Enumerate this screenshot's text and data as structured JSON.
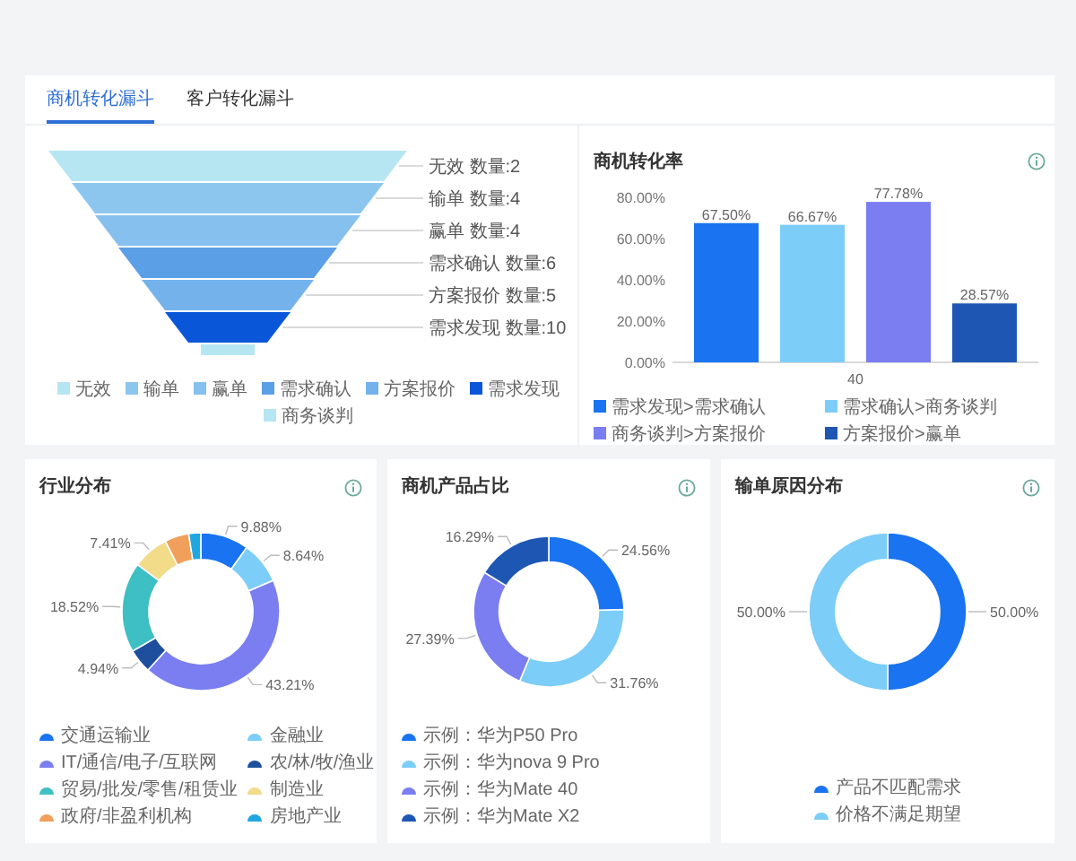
{
  "tabs": [
    {
      "label": "商机转化漏斗",
      "selected": true
    },
    {
      "label": "客户转化漏斗",
      "selected": false
    }
  ],
  "funnel": {
    "layers": [
      {
        "label": "无效 数量:2",
        "color": "#b6e6f2"
      },
      {
        "label": "输单 数量:4",
        "color": "#8cc6ef"
      },
      {
        "label": "赢单 数量:4",
        "color": "#86c0ee"
      },
      {
        "label": "需求确认 数量:6",
        "color": "#5b9fe6"
      },
      {
        "label": "方案报价 数量:5",
        "color": "#74b2ec"
      },
      {
        "label": "需求发现 数量:10",
        "color": "#0a56d8"
      },
      {
        "color": "#b6e6f2"
      }
    ],
    "legend": [
      {
        "name": "无效",
        "color": "#b6e6f2"
      },
      {
        "name": "输单",
        "color": "#8cc6ef"
      },
      {
        "name": "赢单",
        "color": "#86c0ee"
      },
      {
        "name": "需求确认",
        "color": "#5b9fe6"
      },
      {
        "name": "方案报价",
        "color": "#74b2ec"
      },
      {
        "name": "需求发现",
        "color": "#0a56d8"
      },
      {
        "name": "商务谈判",
        "color": "#b6e6f2"
      }
    ]
  },
  "rate_panel": {
    "title": "商机转化率",
    "chart_data": {
      "type": "bar",
      "categories": [
        "40"
      ],
      "series": [
        {
          "name": "需求发现>需求确认",
          "color": "#1a73f0",
          "values": [
            67.5
          ]
        },
        {
          "name": "需求确认>商务谈判",
          "color": "#7ccdf8",
          "values": [
            66.67
          ]
        },
        {
          "name": "商务谈判>方案报价",
          "color": "#7a7ef0",
          "values": [
            77.78
          ]
        },
        {
          "name": "方案报价>赢单",
          "color": "#1d57b3",
          "values": [
            28.57
          ]
        }
      ],
      "ylim": [
        0,
        80
      ],
      "yticks": [
        {
          "value": 0,
          "label": "0.00%"
        },
        {
          "value": 20,
          "label": "20.00%"
        },
        {
          "value": 40,
          "label": "40.00%"
        },
        {
          "value": 60,
          "label": "60.00%"
        },
        {
          "value": 80,
          "label": "80.00%"
        }
      ],
      "value_labels": [
        "67.50%",
        "66.67%",
        "77.78%",
        "28.57%"
      ]
    }
  },
  "cards": [
    {
      "title": "行业分布",
      "chart_data": {
        "type": "donut",
        "categories": [
          "交通运输业",
          "金融业",
          "IT/通信/电子/互联网",
          "农/林/牧/渔业",
          "贸易/批发/零售/租赁业",
          "制造业",
          "政府/非盈利机构",
          "房地产业"
        ],
        "values": [
          9.88,
          8.64,
          43.21,
          4.94,
          18.52,
          7.41,
          4.94,
          2.47
        ],
        "colors": [
          "#1a73f0",
          "#7ccdf8",
          "#7a7ef0",
          "#1d4f9e",
          "#3dbfc4",
          "#f2dc8a",
          "#f0a05a",
          "#21a7e0"
        ],
        "value_labels": [
          "9.88%",
          "8.64%",
          "43.21%",
          "4.94%",
          "18.52%",
          "7.41%",
          null,
          null
        ],
        "legend": "bottom"
      }
    },
    {
      "title": "商机产品占比",
      "chart_data": {
        "type": "donut",
        "categories": [
          "示例：华为P50 Pro",
          "示例：华为nova 9 Pro",
          "示例：华为Mate 40",
          "示例：华为Mate X2"
        ],
        "values": [
          24.56,
          31.76,
          27.39,
          16.29
        ],
        "colors": [
          "#1a73f0",
          "#7ccdf8",
          "#7a7ef0",
          "#1d57b3"
        ],
        "value_labels": [
          "24.56%",
          "31.76%",
          "27.39%",
          "16.29%"
        ],
        "legend": "bottom"
      }
    },
    {
      "title": "输单原因分布",
      "chart_data": {
        "type": "donut",
        "categories": [
          "产品不匹配需求",
          "价格不满足期望"
        ],
        "values": [
          50,
          50
        ],
        "colors": [
          "#1a73f0",
          "#7ccdf8"
        ],
        "value_labels": [
          "50.00%",
          "50.00%"
        ],
        "legend": "bottom"
      }
    }
  ]
}
